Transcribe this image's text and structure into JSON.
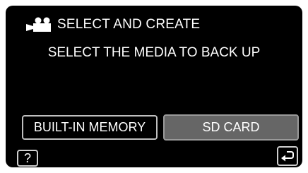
{
  "header": {
    "icon": "video-camera-icon",
    "title": "SELECT AND CREATE"
  },
  "prompt": {
    "text": "SELECT THE MEDIA TO BACK UP"
  },
  "options": {
    "built_in_memory": "BUILT-IN MEMORY",
    "sd_card": "SD CARD"
  },
  "footer": {
    "help_label": "?",
    "back_icon": "return-arrow-icon"
  },
  "colors": {
    "screen_background": "#000000",
    "text": "#ffffff",
    "selected_button": "#666666",
    "button_border": "#bfbfbf"
  }
}
